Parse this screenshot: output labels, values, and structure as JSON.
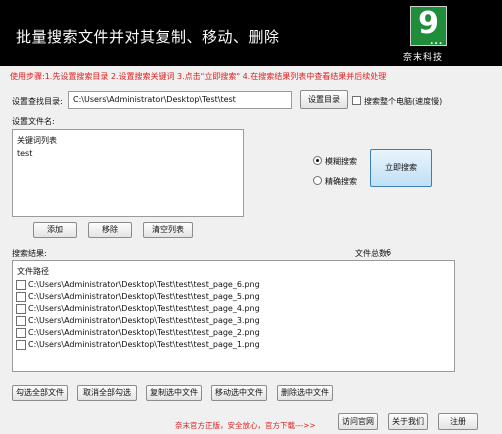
{
  "header": {
    "title": "批量搜索文件并对其复制、移动、删除",
    "logo_glyph": "9",
    "logo_dots": "...",
    "logo_name": "奈末科技",
    "logo_color": "#1f8d3a"
  },
  "steps_text": "使用步骤:1.先设置搜索目录 2.设置搜索关键词 3.点击\"立即搜索\" 4.在搜索结果列表中查看结果并后续处理",
  "directory": {
    "label": "设置查找目录:",
    "value": "C:\\Users\\Administrator\\Desktop\\Test\\test",
    "button": "设置目录",
    "whole_pc_label": "搜索整个电脑(速度慢)",
    "whole_pc_checked": false
  },
  "filename": {
    "label": "设置文件名:",
    "list_header": "关键词列表",
    "keywords": [
      "test"
    ]
  },
  "search_mode": {
    "fuzzy_label": "模糊搜索",
    "exact_label": "精确搜索",
    "selected": "fuzzy",
    "search_button": "立即搜索"
  },
  "keyword_buttons": {
    "add": "添加",
    "remove": "移除",
    "clear": "清空列表"
  },
  "results": {
    "label": "搜索结果:",
    "total_label": "文件总数:",
    "total_value": "6",
    "column_header": "文件路径",
    "rows": [
      "C:\\Users\\Administrator\\Desktop\\Test\\test\\test_page_6.png",
      "C:\\Users\\Administrator\\Desktop\\Test\\test\\test_page_5.png",
      "C:\\Users\\Administrator\\Desktop\\Test\\test\\test_page_4.png",
      "C:\\Users\\Administrator\\Desktop\\Test\\test\\test_page_3.png",
      "C:\\Users\\Administrator\\Desktop\\Test\\test\\test_page_2.png",
      "C:\\Users\\Administrator\\Desktop\\Test\\test\\test_page_1.png"
    ]
  },
  "actions": {
    "check_all": "勾选全部文件",
    "uncheck_all": "取消全部勾选",
    "copy": "复制选中文件",
    "move": "移动选中文件",
    "delete": "删除选中文件"
  },
  "footer": {
    "note": "奈末官方正版，安全放心，官方下载--->>",
    "site": "访问官网",
    "about": "关于我们",
    "register": "注册",
    "note_color": "#e02020"
  }
}
